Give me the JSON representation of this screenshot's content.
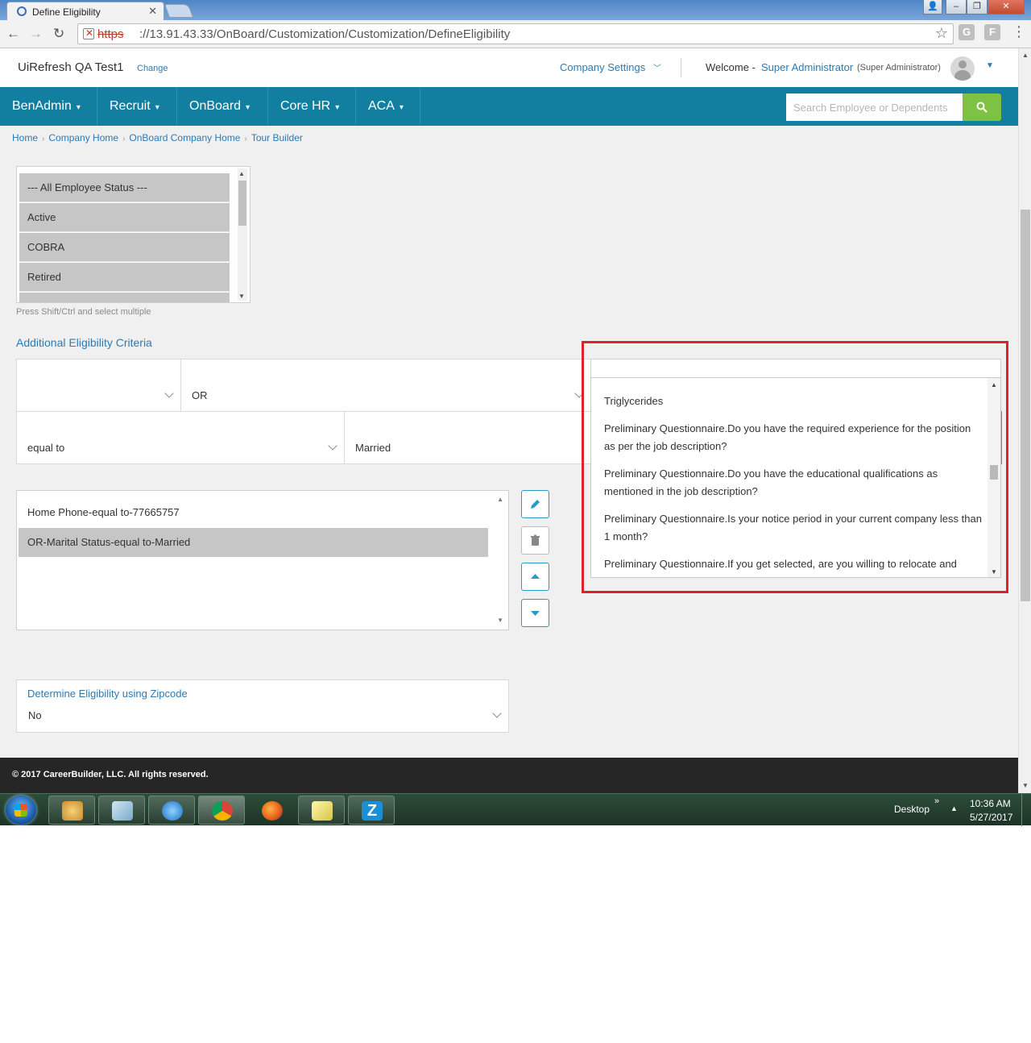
{
  "browser": {
    "tab_title": "Define Eligibility",
    "url_scheme": "https",
    "url_rest": "://13.91.43.33/OnBoard/Customization/Customization/DefineEligibility"
  },
  "header": {
    "company_name": "UiRefresh QA Test1",
    "change_label": "Change",
    "company_settings_label": "Company Settings",
    "welcome_label": "Welcome -",
    "user_name": "Super Administrator",
    "user_role": "(Super Administrator)"
  },
  "nav": {
    "items": [
      "BenAdmin",
      "Recruit",
      "OnBoard",
      "Core HR",
      "ACA"
    ],
    "search_placeholder": "Search Employee or Dependents"
  },
  "breadcrumb": [
    "Home",
    "Company Home",
    "OnBoard Company Home",
    "Tour Builder"
  ],
  "employee_status": {
    "options": [
      "--- All Employee Status ---",
      "Active",
      "COBRA",
      "Retired"
    ],
    "hint": "Press Shift/Ctrl and select multiple"
  },
  "criteria": {
    "section_title": "Additional Eligibility Criteria",
    "field1_value": "",
    "connector_value": "OR",
    "operator_value": "equal to",
    "value_value": "Married",
    "list": [
      "Home Phone-equal to-77665757",
      "OR-Marital Status-equal to-Married"
    ]
  },
  "dropdown": {
    "options": [
      "Triglycerides",
      "Preliminary Questionnaire.Do you have the required experience for the position as per the job description?",
      "Preliminary Questionnaire.Do you have the educational qualifications as mentioned in the job description?",
      "Preliminary Questionnaire.Is your notice period in your current company less than 1 month?",
      "Preliminary Questionnaire.If you get selected, are you willing to relocate and"
    ]
  },
  "zipcode": {
    "label": "Determine Eligibility using Zipcode",
    "value": "No"
  },
  "footer": {
    "text": "© 2017 CareerBuilder, LLC. All rights reserved."
  },
  "taskbar": {
    "desktop_label": "Desktop",
    "time": "10:36 AM",
    "date": "5/27/2017"
  },
  "colors": {
    "nav_bg": "#127fa1",
    "link": "#2a7ab5",
    "search_btn": "#7dc242",
    "highlight_frame": "#e0202a",
    "footer_bg": "#262626"
  }
}
